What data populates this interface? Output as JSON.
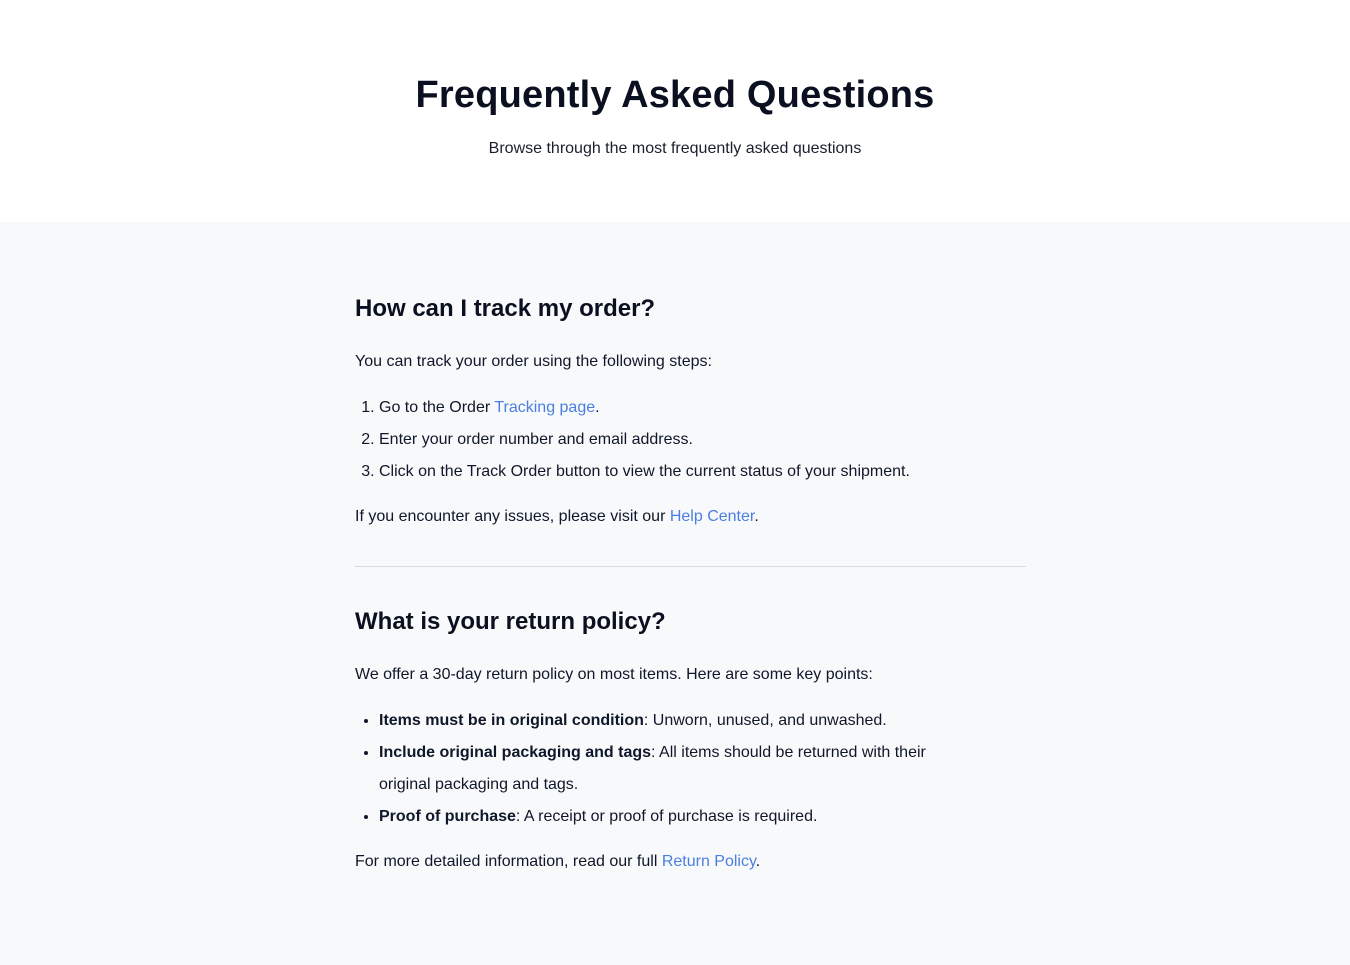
{
  "header": {
    "title": "Frequently Asked Questions",
    "subtitle": "Browse through the most frequently asked questions"
  },
  "faqs": [
    {
      "question": "How can I track my order?",
      "intro": "You can track your order using the following steps:",
      "steps": [
        {
          "text": "Go to the Order ",
          "link": "Tracking page",
          "after": "."
        },
        {
          "text": "Enter your order number and email address."
        },
        {
          "text": "Click on the Track Order button to view the current status of your shipment."
        }
      ],
      "outro": {
        "text": "If you encounter any issues, please visit our ",
        "link": "Help Center",
        "after": "."
      }
    },
    {
      "question": "What is your return policy?",
      "intro": "We offer a 30-day return policy on most items. Here are some key points:",
      "points": [
        {
          "bold": "Items must be in original condition",
          "text": ": Unworn, unused, and unwashed."
        },
        {
          "bold": "Include original packaging and tags",
          "text": ": All items should be returned with their original packaging and tags."
        },
        {
          "bold": "Proof of purchase",
          "text": ": A receipt or proof of purchase is required."
        }
      ],
      "outro": {
        "text": "For more detailed information, read our full ",
        "link": "Return Policy",
        "after": "."
      }
    }
  ],
  "colors": {
    "link": "#4a7fe0",
    "page_bg": "#f8f9fb",
    "header_bg": "#ffffff",
    "text": "#0f172a"
  }
}
